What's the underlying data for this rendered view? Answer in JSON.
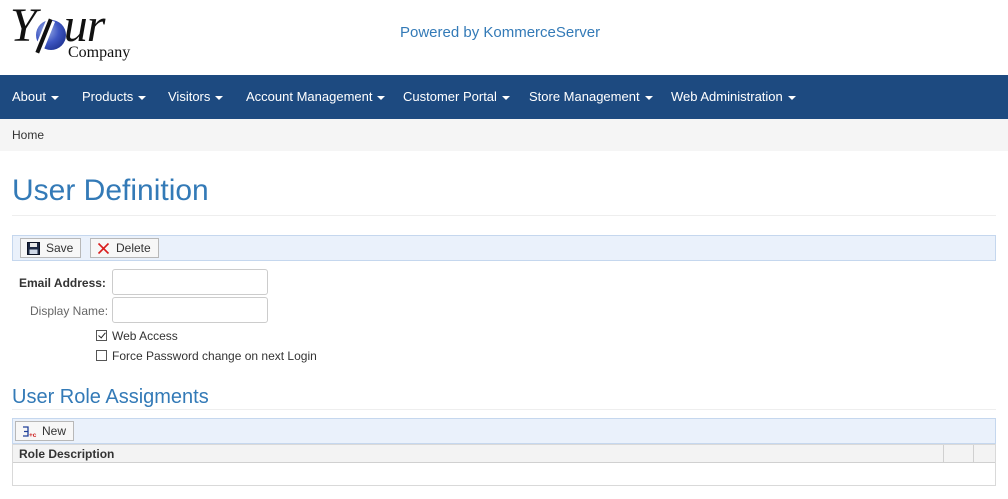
{
  "logo": {
    "word": "Your",
    "word_letter_y": "Y",
    "word_rest": "ur",
    "sub": "Company"
  },
  "header": {
    "powered_by": "Powered by KommerceServer"
  },
  "nav": {
    "items": [
      {
        "label": "About"
      },
      {
        "label": "Products"
      },
      {
        "label": "Visitors"
      },
      {
        "label": "Account Management"
      },
      {
        "label": "Customer Portal"
      },
      {
        "label": "Store Management"
      },
      {
        "label": "Web Administration"
      }
    ]
  },
  "breadcrumb": {
    "home": "Home"
  },
  "page": {
    "title": "User Definition"
  },
  "toolbar": {
    "save_label": "Save",
    "delete_label": "Delete"
  },
  "form": {
    "email_label": "Email Address:",
    "email_value": "",
    "display_name_label": "Display Name:",
    "display_name_value": "",
    "web_access_label": "Web Access",
    "web_access_checked": true,
    "force_password_label": "Force Password change on next Login",
    "force_password_checked": false
  },
  "roles": {
    "title": "User Role Assigments",
    "new_label": "New",
    "columns": [
      "Role Description"
    ],
    "rows": []
  },
  "colors": {
    "brand_blue": "#337ab7",
    "nav_bg": "#1d4a80",
    "toolbar_bg": "#eaf1fb"
  },
  "icons": {
    "save": "floppy-disk-icon",
    "delete": "red-x-icon",
    "new": "new-record-icon",
    "nav_dropdown": "caret-down-icon"
  }
}
